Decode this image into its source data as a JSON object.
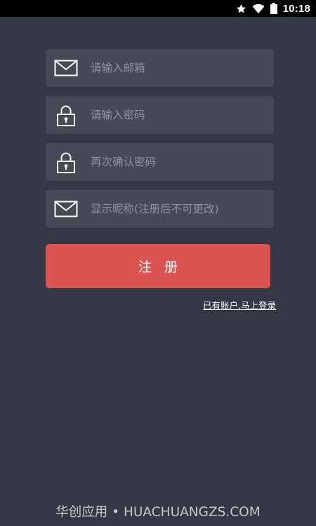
{
  "status_bar": {
    "time": "10:18",
    "icons": [
      "star-icon",
      "wifi-icon",
      "battery-icon"
    ]
  },
  "form": {
    "email_placeholder": "请输入邮箱",
    "password_placeholder": "请输入密码",
    "confirm_password_placeholder": "再次确认密码",
    "nickname_placeholder": "显示昵称(注册后不可更改)"
  },
  "register_button_label": "注 册",
  "login_link_label": "已有账户,马上登录",
  "watermark": "华创应用 • HUACHUANGZS.COM",
  "colors": {
    "background": "#343744",
    "field_background": "#474957",
    "button": "#dc5451",
    "status_bar": "#000000"
  }
}
